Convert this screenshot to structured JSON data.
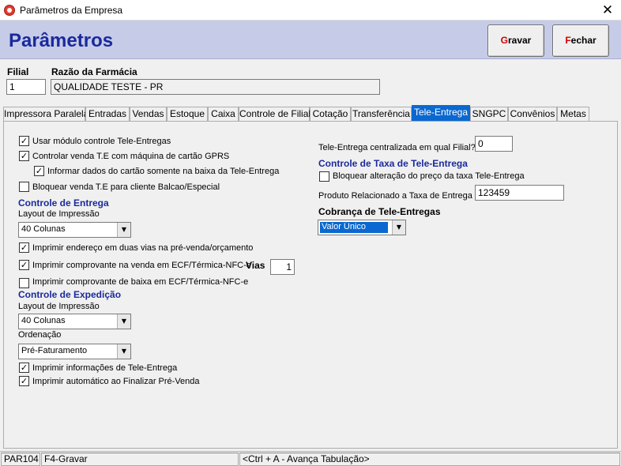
{
  "window": {
    "title": "Parâmetros da Empresa",
    "close": "✕"
  },
  "header": {
    "title": "Parâmetros",
    "gravar_hot": "G",
    "gravar_rest": "ravar",
    "fechar_hot": "F",
    "fechar_rest": "echar"
  },
  "company": {
    "filial_label": "Filial",
    "filial_value": "1",
    "razao_label": "Razão da Farmácia",
    "razao_value": "QUALIDADE TESTE - PR"
  },
  "tabs": [
    "Impressora Paralela",
    "Entradas",
    "Vendas",
    "Estoque",
    "Caixa",
    "Controle de Filial",
    "Cotação",
    "Transferência",
    "Tele-Entrega",
    "SNGPC",
    "Convênios",
    "Metas"
  ],
  "active_tab": "Tele-Entrega",
  "left": {
    "usar_modulo": {
      "label": "Usar módulo controle Tele-Entregas",
      "checked": true
    },
    "controlar_venda": {
      "label": "Controlar venda T.E com máquina de cartão GPRS",
      "checked": true
    },
    "informar_dados": {
      "label": "Informar dados do cartão somente na baixa  da Tele-Entrega",
      "checked": true
    },
    "bloquear_venda": {
      "label": "Bloquear venda T.E para cliente Balcao/Especial",
      "checked": false
    },
    "controle_entrega_title": "Controle de Entrega",
    "layout_label": "Layout de Impressão",
    "layout_value": "40  Colunas",
    "imprimir_endereco": {
      "label": "Imprimir endereço em duas vias na pré-venda/orçamento",
      "checked": true
    },
    "imprimir_comprovante": {
      "label": "Imprimir comprovante na venda em ECF/Térmica-NFC-e",
      "checked": true
    },
    "vias_label": "Vias",
    "vias_value": "1",
    "imprimir_baixa": {
      "label": "Imprimir comprovante de baixa em ECF/Térmica-NFC-e",
      "checked": false
    },
    "controle_expedicao_title": "Controle de Expedição",
    "exp_layout_label": "Layout de Impressão",
    "exp_layout_value": "40 Colunas",
    "ordenacao_label": "Ordenação",
    "ordenacao_value": "Pré-Faturamento",
    "imprimir_info": {
      "label": "Imprimir informações de Tele-Entrega",
      "checked": true
    },
    "imprimir_auto": {
      "label": "Imprimir automático ao Finalizar Pré-Venda",
      "checked": true
    }
  },
  "right": {
    "centralizada_label": "Tele-Entrega centralizada em qual Filial?",
    "centralizada_value": "0",
    "taxa_title": "Controle de Taxa de Tele-Entrega",
    "bloquear_preco": {
      "label": "Bloquear alteração do preço da taxa Tele-Entrega",
      "checked": false
    },
    "produto_label": "Produto Relacionado a Taxa de Entrega",
    "produto_value": "123459",
    "cobranca_title": "Cobrança de Tele-Entregas",
    "cobranca_value": "Valor Único"
  },
  "statusbar": {
    "code": "PAR104",
    "shortcut": "F4-Gravar",
    "hint": "<Ctrl + A - Avança Tabulação>"
  },
  "colors": {
    "header_bg": "#c6cbe8",
    "title_blue": "#1a2a9c",
    "active_tab": "#0a68d0",
    "hotkey_red": "#d00000"
  }
}
